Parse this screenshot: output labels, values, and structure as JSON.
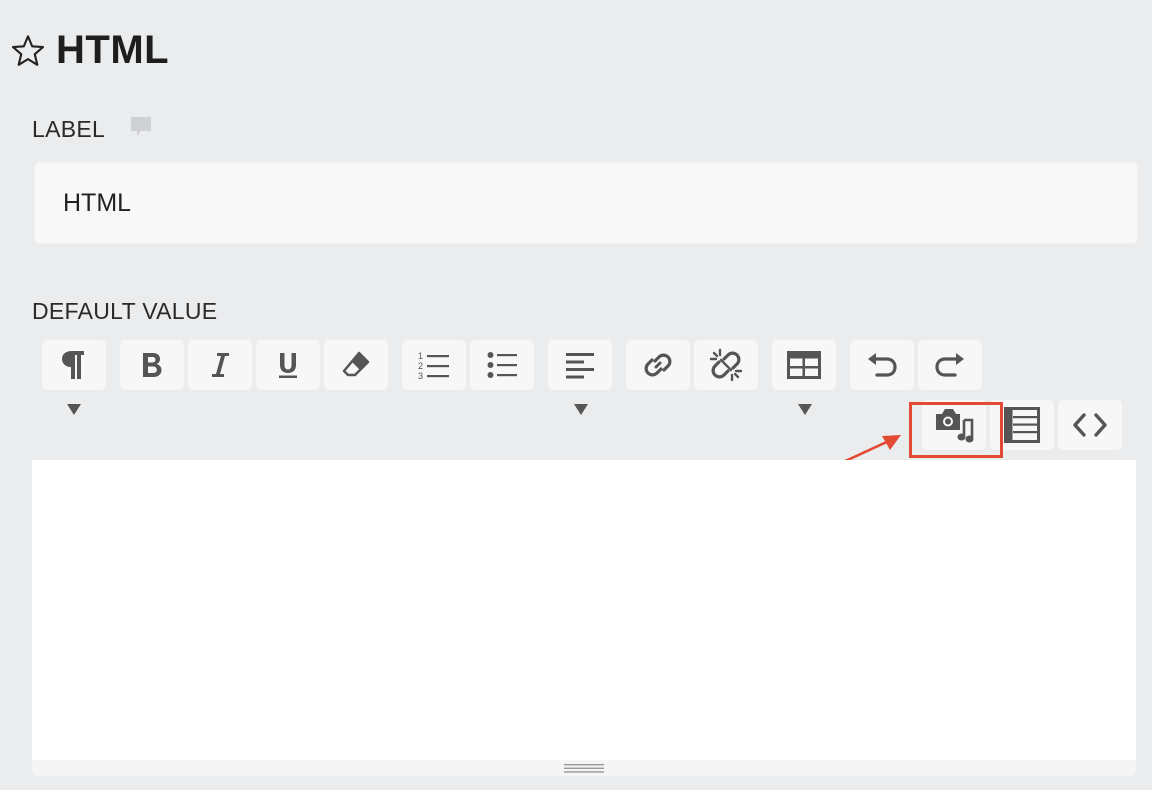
{
  "page": {
    "title": "HTML"
  },
  "label_field": {
    "label": "LABEL",
    "value": "HTML"
  },
  "default_value": {
    "label": "DEFAULT VALUE"
  },
  "toolbar": {
    "row1": [
      {
        "name": "paragraph-format",
        "icon": "paragraph-icon",
        "dropdown": true
      },
      {
        "name": "bold",
        "icon": "bold-icon"
      },
      {
        "name": "italic",
        "icon": "italic-icon"
      },
      {
        "name": "underline",
        "icon": "underline-icon"
      },
      {
        "name": "clear-formatting",
        "icon": "eraser-icon"
      },
      {
        "name": "ordered-list",
        "icon": "ordered-list-icon"
      },
      {
        "name": "unordered-list",
        "icon": "unordered-list-icon"
      },
      {
        "name": "align",
        "icon": "align-left-icon",
        "dropdown": true
      },
      {
        "name": "insert-link",
        "icon": "link-icon"
      },
      {
        "name": "remove-link",
        "icon": "unlink-icon"
      },
      {
        "name": "insert-table",
        "icon": "table-icon",
        "dropdown": true
      },
      {
        "name": "undo",
        "icon": "undo-icon"
      },
      {
        "name": "redo",
        "icon": "redo-icon"
      }
    ],
    "row2": [
      {
        "name": "insert-media",
        "icon": "camera-music-icon",
        "highlighted": true
      },
      {
        "name": "insert-field",
        "icon": "list-icon"
      },
      {
        "name": "source-code",
        "icon": "code-icon"
      }
    ]
  },
  "colors": {
    "highlight": "#e24a33",
    "background": "#ebecee",
    "button": "#f7f7f7",
    "icon": "#555555"
  }
}
